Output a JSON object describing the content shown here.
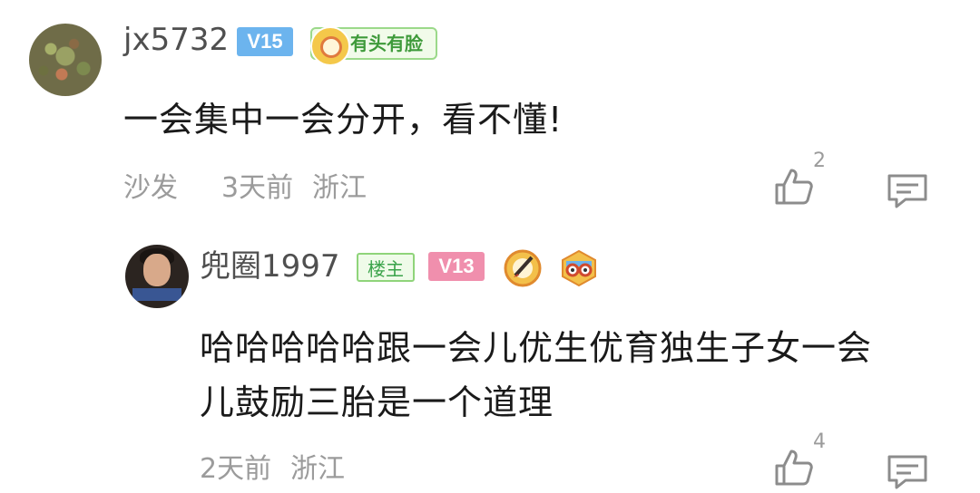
{
  "comment1": {
    "username": "jx5732",
    "level": "V15",
    "medal": "有头有脸",
    "content": "一会集中一会分开，看不懂!",
    "sofa": "沙发",
    "time": "3天前",
    "location": "浙江",
    "likes": "2"
  },
  "reply1": {
    "username": "兜圈1997",
    "owner_badge": "楼主",
    "level": "V13",
    "content_line1": "哈哈哈哈哈跟一会儿优生优育独生子女一会",
    "content_line2": "儿鼓励三胎是一个道理",
    "time": "2天前",
    "location": "浙江",
    "likes": "4"
  },
  "icons": {
    "like": "thumbs-up-icon",
    "reply": "comment-bubble-icon",
    "medal_pen": "pen-medal-icon",
    "medal_owl": "owl-medal-icon"
  }
}
